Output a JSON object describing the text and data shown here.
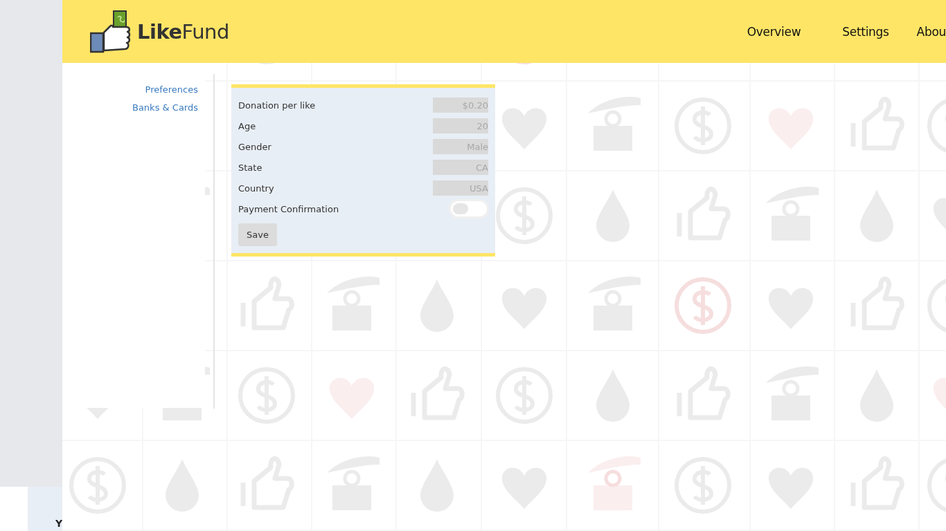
{
  "logo": {
    "text": "**Like**Fund"
  },
  "nav": [
    {
      "label": "Overview"
    },
    {
      "label": "Settings"
    },
    {
      "label": "Abou"
    }
  ],
  "sidebar": {
    "items": [
      {
        "label": "Preferences"
      },
      {
        "label": "Banks & Cards"
      }
    ]
  },
  "form": {
    "fields": [
      {
        "label": "Donation per like",
        "kind": "text",
        "value": "$0.20"
      },
      {
        "label": "Age",
        "kind": "text",
        "value": "20"
      },
      {
        "label": "Gender",
        "kind": "text",
        "value": "Male"
      },
      {
        "label": "State",
        "kind": "text",
        "value": "CA"
      },
      {
        "label": "Country",
        "kind": "text",
        "value": "USA"
      },
      {
        "label": "Payment Confirmation",
        "kind": "toggle",
        "on": false
      }
    ],
    "save_button": "Save"
  },
  "behind_panel": {
    "text": "Y"
  }
}
